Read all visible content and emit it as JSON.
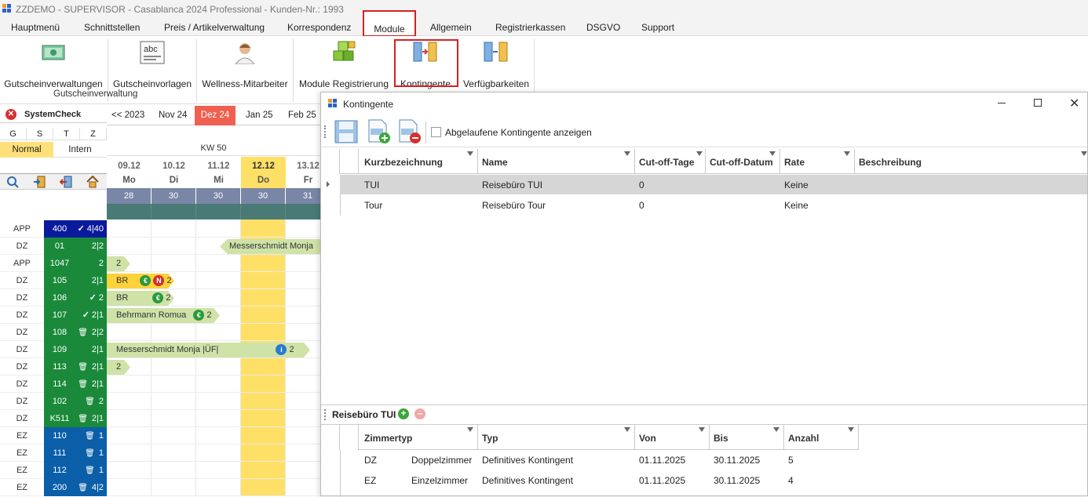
{
  "window": {
    "title": "ZZDEMO - SUPERVISOR - Casablanca 2024 Professional -  Kunden-Nr.: 1993"
  },
  "menu": [
    "Hauptmenü",
    "Schnittstellen",
    "Preis / Artikelverwaltung",
    "Korrespondenz",
    "Module",
    "Allgemein",
    "Registrierkassen",
    "DSGVO",
    "Support"
  ],
  "ribbon": {
    "buttons": [
      "Gutscheinverwaltungen",
      "Gutscheinvorlagen",
      "Wellness-Mitarbeiter",
      "Module Registrierung",
      "Kontingente",
      "Verfügbarkeiten"
    ],
    "group": "Gutscheinverwaltung"
  },
  "left": {
    "systemcheck": "SystemCheck",
    "cols": [
      "G",
      "S",
      "T",
      "Z"
    ],
    "normal": "Normal",
    "intern": "Intern"
  },
  "calendar": {
    "months": [
      "<< 2023",
      "Nov 24",
      "Dez 24",
      "Jan 25",
      "Feb 25"
    ],
    "week": "KW 50",
    "dates": [
      "09.12",
      "10.12",
      "11.12",
      "12.12",
      "13.12"
    ],
    "days": [
      "Mo",
      "Di",
      "Mi",
      "Do",
      "Fr"
    ],
    "counts": [
      "28",
      "30",
      "30",
      "30",
      "31"
    ]
  },
  "rooms": [
    {
      "type": "APP",
      "num": "400",
      "count": "4|40",
      "check": true,
      "trash": false,
      "color": "#0a1a9c"
    },
    {
      "type": "DZ",
      "num": "01",
      "count": "2|2",
      "check": false,
      "trash": false,
      "color": "#1a8a3a"
    },
    {
      "type": "APP",
      "num": "1047",
      "count": "2",
      "check": false,
      "trash": false,
      "color": "#1a8a3a"
    },
    {
      "type": "DZ",
      "num": "105",
      "count": "2|1",
      "check": false,
      "trash": false,
      "color": "#1a8a3a"
    },
    {
      "type": "DZ",
      "num": "106",
      "count": "2",
      "check": true,
      "trash": false,
      "color": "#1a8a3a"
    },
    {
      "type": "DZ",
      "num": "107",
      "count": "2|1",
      "check": true,
      "trash": false,
      "color": "#1a8a3a"
    },
    {
      "type": "DZ",
      "num": "108",
      "count": "2|2",
      "check": false,
      "trash": true,
      "color": "#1a8a3a"
    },
    {
      "type": "DZ",
      "num": "109",
      "count": "2|1",
      "check": false,
      "trash": false,
      "color": "#1a8a3a"
    },
    {
      "type": "DZ",
      "num": "113",
      "count": "2|1",
      "check": false,
      "trash": true,
      "color": "#1a8a3a"
    },
    {
      "type": "DZ",
      "num": "114",
      "count": "2|1",
      "check": false,
      "trash": true,
      "color": "#1a8a3a"
    },
    {
      "type": "DZ",
      "num": "102",
      "count": "2",
      "check": false,
      "trash": true,
      "color": "#1a8a3a"
    },
    {
      "type": "DZ",
      "num": "K511",
      "count": "2|1",
      "check": false,
      "trash": true,
      "color": "#1a8a3a"
    },
    {
      "type": "EZ",
      "num": "110",
      "count": "1",
      "check": false,
      "trash": true,
      "color": "#0a5fa8"
    },
    {
      "type": "EZ",
      "num": "111",
      "count": "1",
      "check": false,
      "trash": true,
      "color": "#0a5fa8"
    },
    {
      "type": "EZ",
      "num": "112",
      "count": "1",
      "check": false,
      "trash": true,
      "color": "#0a5fa8"
    },
    {
      "type": "EZ",
      "num": "200",
      "count": "4|2",
      "check": false,
      "trash": true,
      "color": "#0a5fa8"
    }
  ],
  "bookings": {
    "b1": "Messerschmidt Monja",
    "b2": "2",
    "b3_name": "BR",
    "b3_count": "2",
    "b4_name": "BR",
    "b4_count": "2",
    "b5_name": "Behrmann Romua",
    "b5_count": "2",
    "b6_name": "Messerschmidt Monja |ÜF|",
    "b6_count": "2",
    "b7": "2"
  },
  "dialog": {
    "title": "Kontingente",
    "checkbox": "Abgelaufene Kontingente anzeigen",
    "headers": [
      "Kurzbezeichnung",
      "Name",
      "Cut-off-Tage",
      "Cut-off-Datum",
      "Rate",
      "Beschreibung"
    ],
    "rows": [
      {
        "short": "TUI",
        "name": "Reisebüro TUI",
        "cutoff": "0",
        "rate": "Keine"
      },
      {
        "short": "Tour",
        "name": "Reisebüro Tour",
        "cutoff": "0",
        "rate": "Keine"
      }
    ],
    "detail_title": "Reisebüro TUI",
    "detail_headers": [
      "Zimmertyp",
      "Typ",
      "Von",
      "Bis",
      "Anzahl"
    ],
    "detail_rows": [
      {
        "code": "DZ",
        "room": "Doppelzimmer",
        "typ": "Definitives Kontingent",
        "von": "01.11.2025",
        "bis": "30.11.2025",
        "anzahl": "5"
      },
      {
        "code": "EZ",
        "room": "Einzelzimmer",
        "typ": "Definitives Kontingent",
        "von": "01.11.2025",
        "bis": "30.11.2025",
        "anzahl": "4"
      }
    ]
  }
}
